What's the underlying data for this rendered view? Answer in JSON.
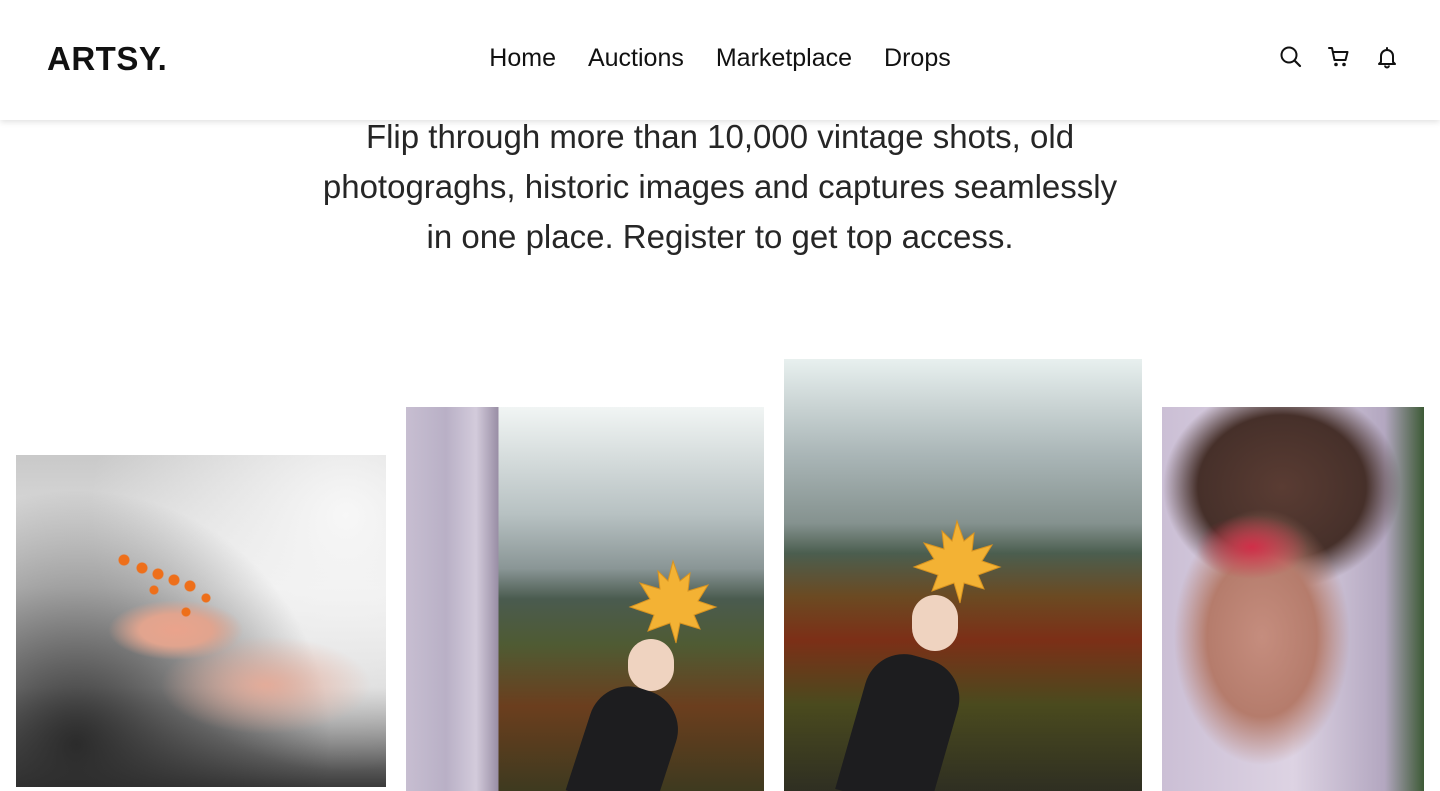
{
  "brand": {
    "logo": "ARTSY."
  },
  "nav": {
    "links": [
      {
        "label": "Home"
      },
      {
        "label": "Auctions"
      },
      {
        "label": "Marketplace"
      },
      {
        "label": "Drops"
      }
    ],
    "icons": [
      "search-icon",
      "cart-icon",
      "bell-icon"
    ]
  },
  "hero": {
    "description": "Flip through more than 10,000 vintage shots, old photograghs, historic images and captures seamlessly in one place. Register to get top access."
  },
  "gallery": {
    "items": [
      {
        "subject": "hand-with-orange-berries"
      },
      {
        "subject": "foil-and-maple-leaf"
      },
      {
        "subject": "maple-leaf-over-forest"
      },
      {
        "subject": "person-with-red-glasses"
      }
    ]
  },
  "colors": {
    "text": "#1f1f1f",
    "background": "#ffffff",
    "leaf": "#f3b234"
  }
}
